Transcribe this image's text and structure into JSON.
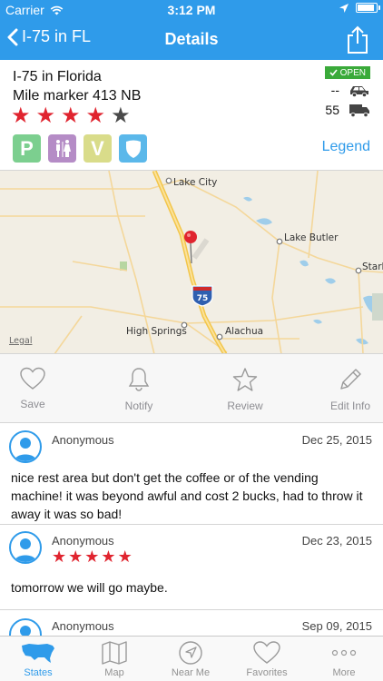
{
  "status_bar": {
    "carrier": "Carrier",
    "time": "3:12 PM"
  },
  "nav": {
    "back_label": "I-75 in FL",
    "title": "Details"
  },
  "rest_area": {
    "title": "I-75 in Florida",
    "mile_marker": "Mile marker 413 NB",
    "rating": 4,
    "rating_max": 5,
    "open_label": "OPEN",
    "car_spaces": "--",
    "truck_spaces": "55",
    "amenities": [
      {
        "icon": "parking-icon",
        "label": "P",
        "color": "#7ccf8f"
      },
      {
        "icon": "restrooms-icon",
        "label": "",
        "color": "#b58cc6"
      },
      {
        "icon": "vending-icon",
        "label": "V",
        "color": "#d9dc8a"
      },
      {
        "icon": "security-icon",
        "label": "",
        "color": "#5bb8ea"
      }
    ],
    "legend_label": "Legend"
  },
  "map": {
    "labels": {
      "lake_city": "Lake City",
      "lake_butler": "Lake Butler",
      "stark": "Stark",
      "high_springs": "High Springs",
      "alachua": "Alachua",
      "shield": "75",
      "legal": "Legal"
    }
  },
  "actions": {
    "save": "Save",
    "notify": "Notify",
    "review": "Review",
    "edit": "Edit Info"
  },
  "reviews": [
    {
      "author": "Anonymous",
      "date": "Dec 25, 2015",
      "rating": 0,
      "text": "nice rest area but don't get the coffee or of the vending machine!  it was beyond awful and cost 2 bucks, had to throw it away it was so bad!"
    },
    {
      "author": "Anonymous",
      "date": "Dec 23, 2015",
      "rating": 5,
      "text": "tomorrow  we will go maybe."
    },
    {
      "author": "Anonymous",
      "date": "Sep 09, 2015",
      "rating": 0,
      "text": ""
    }
  ],
  "tabs": [
    {
      "label": "States",
      "icon": "usa-map-icon",
      "active": true
    },
    {
      "label": "Map",
      "icon": "folded-map-icon",
      "active": false
    },
    {
      "label": "Near Me",
      "icon": "compass-icon",
      "active": false
    },
    {
      "label": "Favorites",
      "icon": "heart-icon",
      "active": false
    },
    {
      "label": "More",
      "icon": "more-dots-icon",
      "active": false
    }
  ],
  "colors": {
    "accent": "#2f9bea",
    "star": "#e0242f",
    "star_empty": "#4a4a4a",
    "open": "#3aaa3a"
  }
}
